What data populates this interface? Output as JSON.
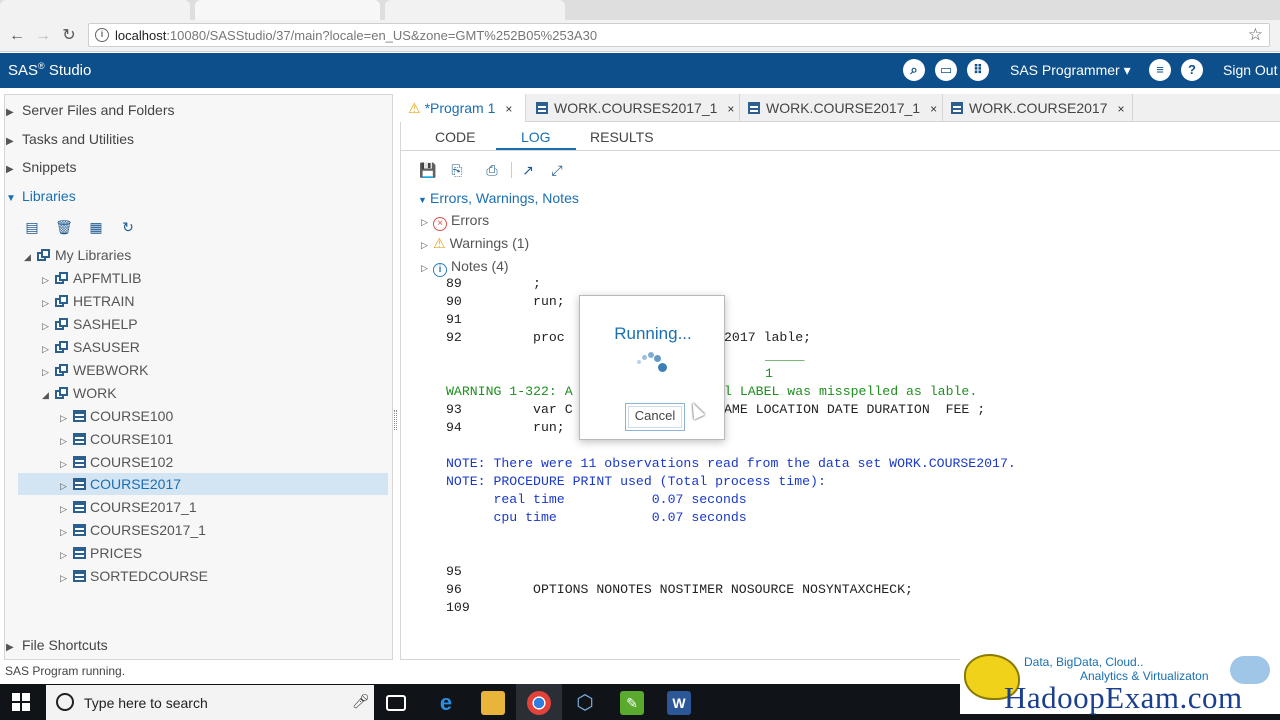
{
  "browser": {
    "url_host": "localhost",
    "url_rest": ":10080/SASStudio/37/main?locale=en_US&zone=GMT%252B05%253A30"
  },
  "header": {
    "app_title": "SAS",
    "app_title_suffix": "Studio",
    "user_menu": "SAS Programmer ▾",
    "sign_out": "Sign Out"
  },
  "navigation": {
    "sections": {
      "server_files": "Server Files and Folders",
      "tasks": "Tasks and Utilities",
      "snippets": "Snippets",
      "libraries": "Libraries",
      "file_shortcuts": "File Shortcuts"
    },
    "my_libraries": "My Libraries",
    "libraries": [
      "APFMTLIB",
      "HETRAIN",
      "SASHELP",
      "SASUSER",
      "WEBWORK",
      "WORK"
    ],
    "work_tables": [
      "COURSE100",
      "COURSE101",
      "COURSE102",
      "COURSE2017",
      "COURSE2017_1",
      "COURSES2017_1",
      "PRICES",
      "SORTEDCOURSE"
    ],
    "selected_table": "COURSE2017"
  },
  "status": {
    "text": "SAS Program running."
  },
  "editor": {
    "tabs": [
      {
        "label": "*Program 1",
        "close": "×"
      },
      {
        "label": "WORK.COURSES2017_1",
        "close": "×"
      },
      {
        "label": "WORK.COURSE2017_1",
        "close": "×"
      },
      {
        "label": "WORK.COURSE2017",
        "close": "×"
      }
    ],
    "subtabs": [
      "CODE",
      "LOG",
      "RESULTS"
    ],
    "active_subtab": "LOG",
    "messages": {
      "header": "Errors, Warnings, Notes",
      "errors": "Errors",
      "warnings": "Warnings (1)",
      "notes": "Notes (4)"
    },
    "log_lines": {
      "l89": "89         ;",
      "l90": "90         run;",
      "l91": "91",
      "l92a": "92         proc",
      "l92b": "2017 lable;",
      "underline": "_____",
      "one": "1",
      "warnA": "WARNING 1-322: A",
      "warnB": "l LABEL was misspelled as lable.",
      "l93a": "93         var C",
      "l93b": "AME LOCATION DATE DURATION  FEE ;",
      "l94": "94         run;",
      "note1": "NOTE: There were 11 observations read from the data set WORK.COURSE2017.",
      "note2": "NOTE: PROCEDURE PRINT used (Total process time):",
      "note3": "      real time           0.07 seconds",
      "note4": "      cpu time            0.07 seconds",
      "l95": "95",
      "l96": "96         OPTIONS NONOTES NOSTIMER NOSOURCE NOSYNTAXCHECK;",
      "l109": "109"
    }
  },
  "dialog": {
    "title": "Running...",
    "cancel": "Cancel"
  },
  "taskbar": {
    "search_placeholder": "Type here to search"
  },
  "watermark": {
    "line1": "Data, BigData, Cloud..",
    "line2": "Analytics & Virtualizaton",
    "brand": "HadoopExam.com"
  },
  "colors": {
    "header_bg": "#0d4f8a",
    "accent": "#1a6fb3",
    "warning_text": "#1f8f1f",
    "note_text": "#1a39c8"
  }
}
